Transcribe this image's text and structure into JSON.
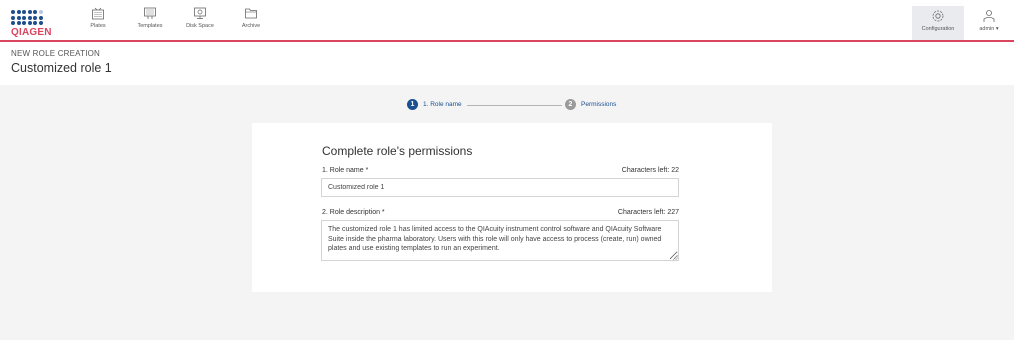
{
  "brand": {
    "logo_text": "QIAGEN",
    "accent": "#d9455f",
    "primary": "#1a4f91"
  },
  "nav": {
    "items": [
      {
        "label": "Plates",
        "icon": "plates-icon"
      },
      {
        "label": "Templates",
        "icon": "templates-icon"
      },
      {
        "label": "Disk Space",
        "icon": "disk-space-icon"
      },
      {
        "label": "Archive",
        "icon": "archive-icon"
      }
    ],
    "configuration_label": "Configuration",
    "user_label": "admin ▾"
  },
  "header": {
    "breadcrumb": "NEW ROLE CREATION",
    "title": "Customized role 1"
  },
  "stepper": {
    "steps": [
      {
        "number": "1",
        "label": "1. Role name",
        "state": "active"
      },
      {
        "number": "2",
        "label": "Permissions",
        "state": "inactive"
      }
    ]
  },
  "form": {
    "title": "Complete role's permissions",
    "role_name": {
      "label": "1. Role name *",
      "counter": "Characters left: 22",
      "value": "Customized role 1"
    },
    "role_description": {
      "label": "2. Role description *",
      "counter": "Characters left: 227",
      "value": "The customized role 1 has limited access to the QIAcuity instrument control software and QIAcuity Software Suite inside the pharma laboratory. Users with this role will only have access to process (create, run) owned plates and use existing templates to run an experiment."
    }
  }
}
